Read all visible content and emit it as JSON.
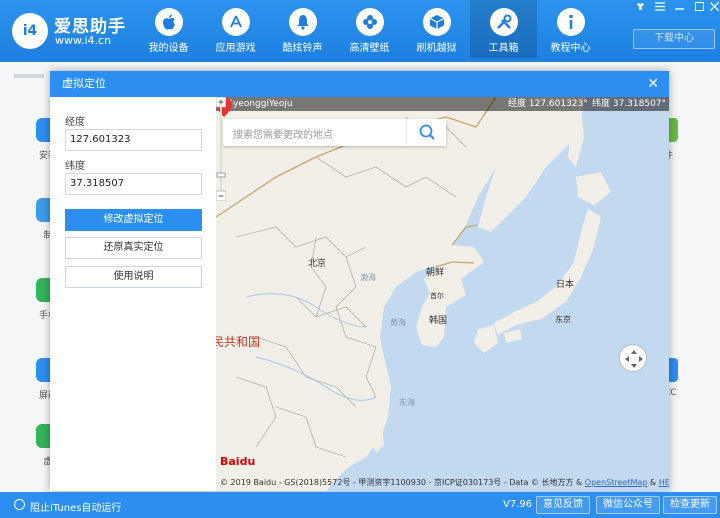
{
  "brand": {
    "logo_text": "i4",
    "name": "爱思助手",
    "url": "www.i4.cn"
  },
  "nav": [
    {
      "label": "我的设备",
      "icon": "apple-icon"
    },
    {
      "label": "应用游戏",
      "icon": "app-store-icon"
    },
    {
      "label": "酷炫铃声",
      "icon": "bell-icon"
    },
    {
      "label": "高清壁纸",
      "icon": "flower-icon"
    },
    {
      "label": "刷机越狱",
      "icon": "box-icon"
    },
    {
      "label": "工具箱",
      "icon": "tools-icon",
      "active": true
    },
    {
      "label": "教程中心",
      "icon": "info-icon"
    }
  ],
  "download_center": "下载中心",
  "background": {
    "left_items": [
      "安装",
      "制",
      "手机",
      "屏蔽",
      "虚"
    ],
    "right_items": [
      "件",
      "CC"
    ]
  },
  "dialog": {
    "title": "虚拟定位",
    "longitude_label": "经度",
    "longitude_value": "127.601323",
    "latitude_label": "纬度",
    "latitude_value": "37.318507",
    "modify_button": "修改虚拟定位",
    "restore_button": "还原真实定位",
    "help_button": "使用说明"
  },
  "map": {
    "location_name": "GyeonggiYeoju",
    "longitude_readout": "经度 127.601323°",
    "latitude_readout": "纬度 37.318507°",
    "search_placeholder": "搜索您需要更改的地点",
    "labels": {
      "beijing": "北京",
      "bohai": "渤海",
      "north_korea": "朝鲜",
      "seoul": "首尔",
      "south_korea": "韩国",
      "yellow_sea": "黄海",
      "japan": "日本",
      "tokyo": "东京",
      "east_sea": "东海",
      "china": "民共和国"
    },
    "baidu": "Baidu",
    "copyright": "© 2019 Baidu - GS(2018)5572号 - 甲测资字1100930 - 京ICP证030173号 - Data © 长地万方 &",
    "copyright_link1": "OpenStreetMap",
    "copyright_and": "&",
    "copyright_link2": "HERE"
  },
  "statusbar": {
    "itunes": "阻止iTunes自动运行",
    "version": "V7.96",
    "feedback": "意见反馈",
    "wechat": "微信公众号",
    "update": "检查更新"
  }
}
